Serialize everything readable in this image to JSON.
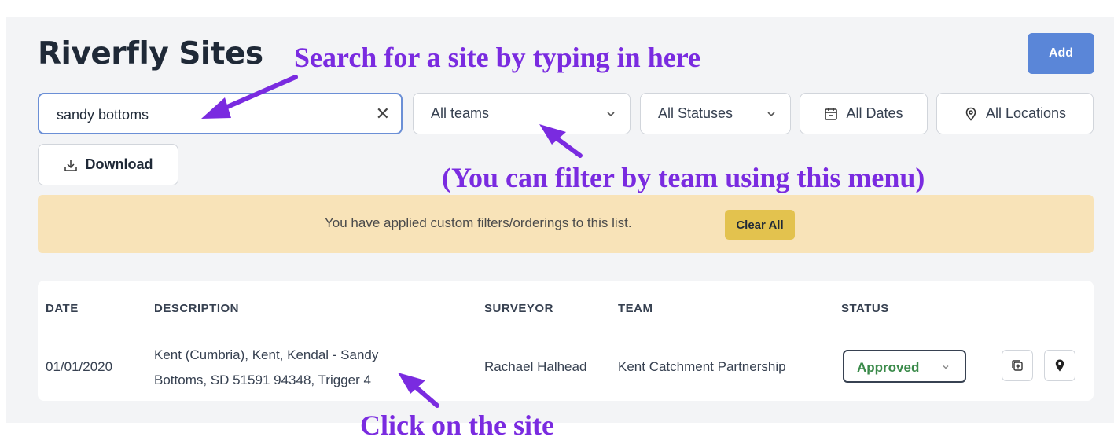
{
  "page": {
    "title": "Riverfly Sites",
    "add_label": "Add"
  },
  "search": {
    "value": "sandy bottoms",
    "placeholder": "",
    "clear_symbol": "✕"
  },
  "filters": {
    "teams": "All teams",
    "statuses": "All Statuses",
    "dates": "All Dates",
    "locations": "All Locations"
  },
  "download_label": "Download",
  "banner": {
    "text": "You have applied custom filters/orderings to this list.",
    "clear_all": "Clear All"
  },
  "table": {
    "headers": {
      "date": "DATE",
      "description": "DESCRIPTION",
      "surveyor": "SURVEYOR",
      "team": "TEAM",
      "status": "STATUS"
    },
    "rows": [
      {
        "date": "01/01/2020",
        "description_line1": "Kent (Cumbria), Kent, Kendal - Sandy",
        "description_line2": "Bottoms, SD 51591 94348, Trigger 4",
        "surveyor": "Rachael Halhead",
        "team": "Kent Catchment Partnership",
        "status": "Approved"
      }
    ]
  },
  "annotations": {
    "search_hint": "Search for a site by typing in here",
    "team_hint": "(You can filter by team using this menu)",
    "click_hint": "Click on the site"
  },
  "colors": {
    "annotation": "#7a2be0",
    "primary": "#5a86d8",
    "banner_bg": "#f8e3b8",
    "clear_all_bg": "#e3c24e",
    "approved": "#3a8a4a"
  },
  "icons": {
    "clear": "close-icon",
    "chevron": "chevron-down-icon",
    "dates": "calendar-icon",
    "locations": "location-pin-icon",
    "download": "download-icon",
    "duplicate": "copy-add-icon",
    "map": "map-pin-icon"
  }
}
